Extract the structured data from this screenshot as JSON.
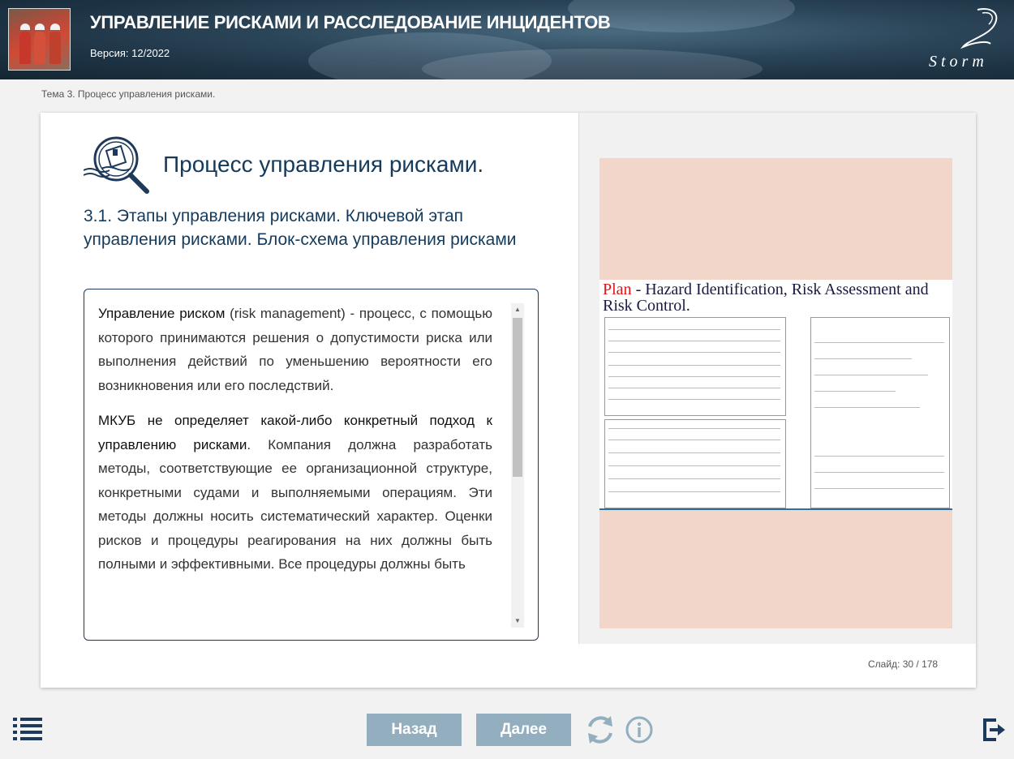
{
  "header": {
    "title": "УПРАВЛЕНИЕ РИСКАМИ И РАССЛЕДОВАНИЕ ИНЦИДЕНТОВ",
    "version": "Версия: 12/2022",
    "logo_text": "Storm"
  },
  "breadcrumb": "Тема 3. Процесс управления рисками.",
  "content": {
    "title": "Процесс управления рисками.",
    "subtitle": "3.1. Этапы управления рисками. Ключевой этап управления рисками. Блок-схема управления рисками",
    "paragraph1_bold": "Управление риском",
    "paragraph1_rest": " (risk management) - процесс, с помощью которого принимаются решения о допустимости риска или выполнения действий по уменьшению вероятности его возникновения или его последствий.",
    "paragraph2_bold": "МКУБ не определяет какой-либо конкретный подход к управлению рисками",
    "paragraph2_rest": ". Компания должна разработать методы, соответствующие ее организационной структуре, конкретными судами и выполняемыми операциям. Эти методы должны носить систематический характер. Оценки рисков и процедуры реагирования на них должны быть полными и эффективными. Все процедуры должны быть"
  },
  "slide_image": {
    "plan_word": "Plan",
    "plan_rest": " - Hazard Identification, Risk Assessment and Risk Control."
  },
  "slide_counter": "Слайд:  30 / 178",
  "nav": {
    "back_label": "Назад",
    "next_label": "Далее"
  },
  "icons": {
    "menu": "list-menu-icon",
    "reload": "reload-icon",
    "info": "info-icon",
    "exit": "exit-icon",
    "topic": "magnifier-ship-icon"
  },
  "colors": {
    "title": "#143a5c",
    "button": "#93aebf",
    "slide_bg": "#f2d6c9",
    "plan_red": "#e01515"
  }
}
